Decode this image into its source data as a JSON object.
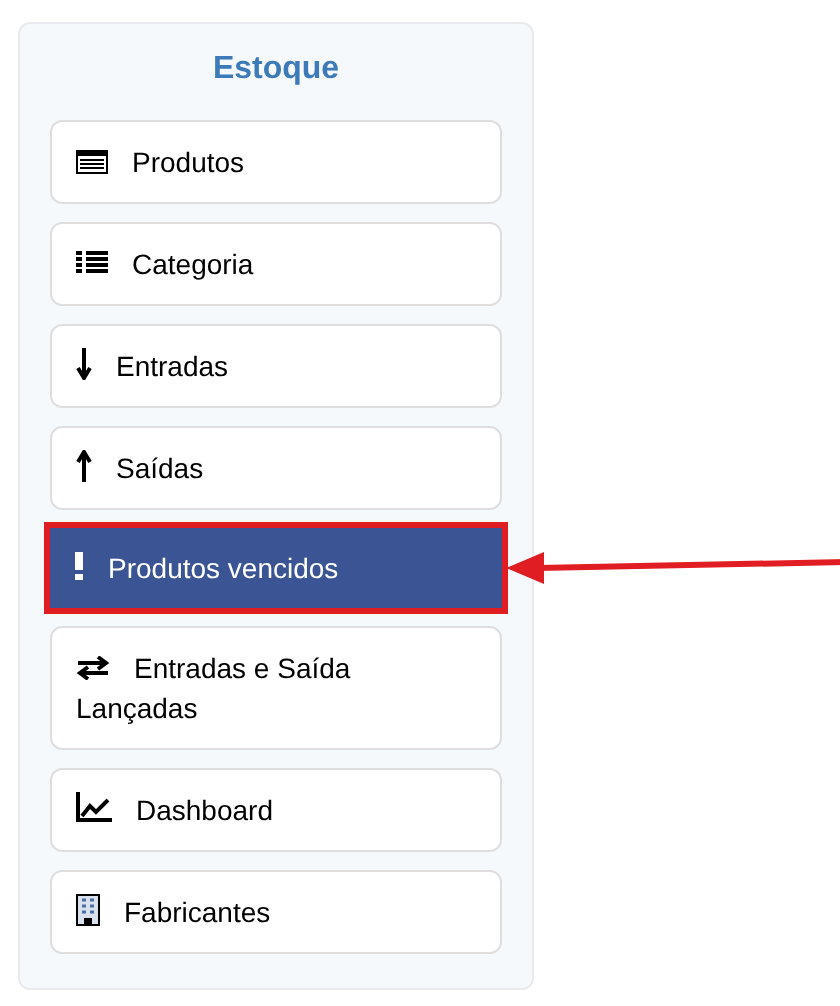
{
  "sidebar": {
    "title": "Estoque",
    "items": [
      {
        "label": "Produtos",
        "kind": "table",
        "selected": false,
        "highlighted": false
      },
      {
        "label": "Categoria",
        "kind": "list",
        "selected": false,
        "highlighted": false
      },
      {
        "label": "Entradas",
        "kind": "down",
        "selected": false,
        "highlighted": false
      },
      {
        "label": "Saídas",
        "kind": "up",
        "selected": false,
        "highlighted": false
      },
      {
        "label": "Produtos vencidos",
        "kind": "alert",
        "selected": true,
        "highlighted": true
      },
      {
        "label": "Entradas e Saída Lançadas",
        "kind": "swap",
        "selected": false,
        "highlighted": false
      },
      {
        "label": "Dashboard",
        "kind": "chart",
        "selected": false,
        "highlighted": false
      },
      {
        "label": "Fabricantes",
        "kind": "building",
        "selected": false,
        "highlighted": false
      }
    ]
  }
}
